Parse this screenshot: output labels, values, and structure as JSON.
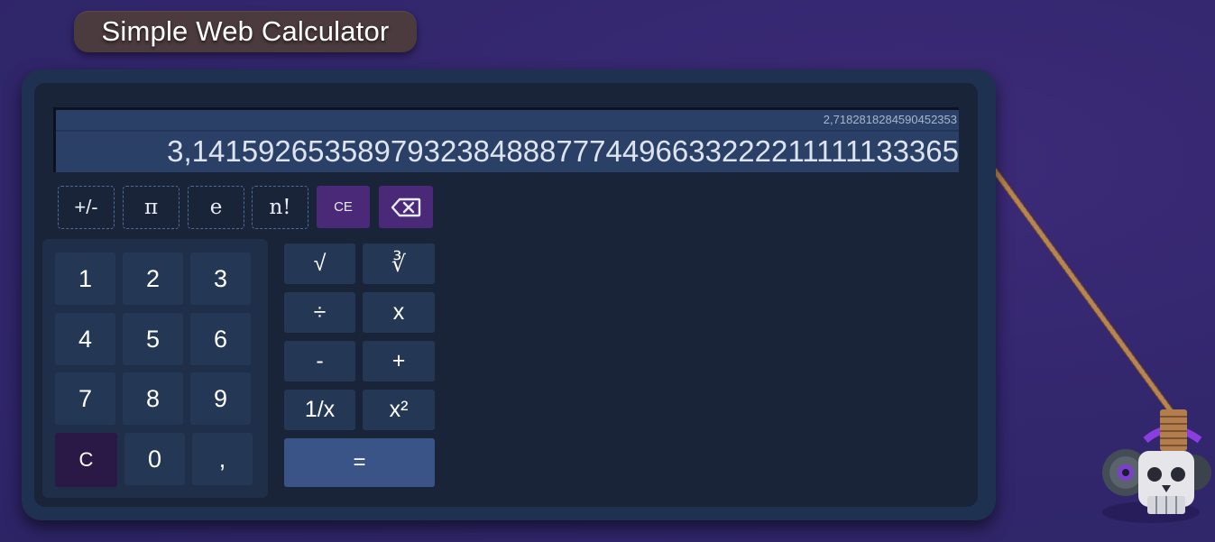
{
  "app": {
    "title": "Simple Web Calculator"
  },
  "display": {
    "previous": "2,7182818284590452353",
    "current": "3,14159265358979323848887774496633222211111133365"
  },
  "function_row": {
    "negate": "+/-",
    "pi": "π",
    "e": "e",
    "factorial": "n!",
    "clear_entry": "CE",
    "backspace_icon": "backspace-icon"
  },
  "numpad": {
    "keys": [
      "1",
      "2",
      "3",
      "4",
      "5",
      "6",
      "7",
      "8",
      "9",
      "C",
      "0",
      ","
    ]
  },
  "operators": {
    "sqrt": "√",
    "cbrt": "∛",
    "divide": "÷",
    "multiply": "x",
    "minus": "-",
    "plus": "+",
    "reciprocal": "1/x",
    "square": "x²",
    "equals": "="
  },
  "colors": {
    "background": "#33276e",
    "calc_frame": "#1f3150",
    "calc_body": "#192438",
    "display": "#2a4066",
    "key": "#243856",
    "purple_accent": "#4a2a78",
    "equals": "#3a5488"
  },
  "decor": {
    "robot_icon": "skull-robot-icon",
    "rope": "rope"
  }
}
